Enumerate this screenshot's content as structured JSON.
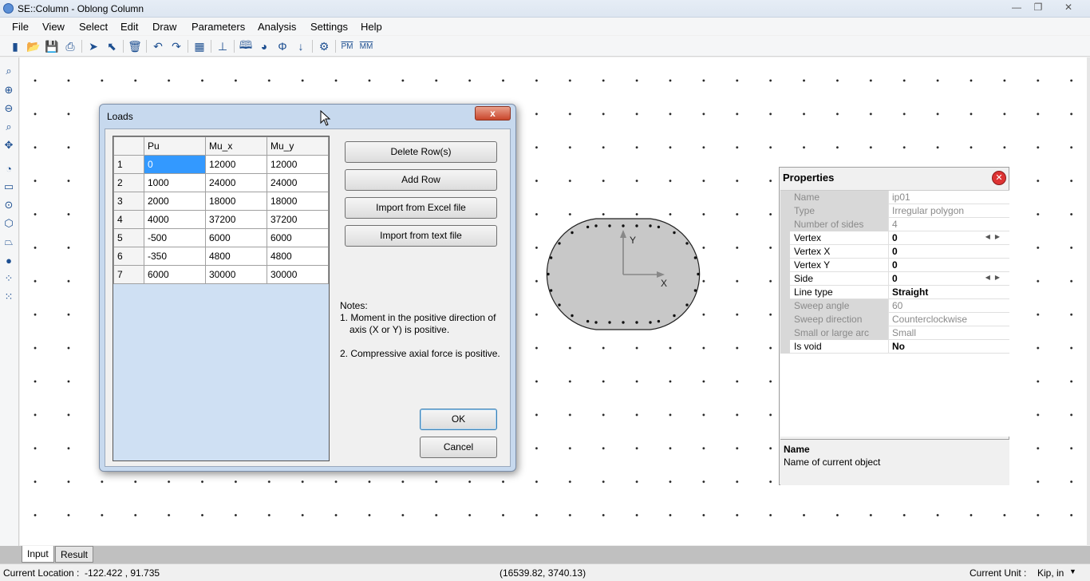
{
  "window": {
    "title": "SE::Column - Oblong Column",
    "min": "—",
    "max": "❐",
    "close": "✕"
  },
  "menu": [
    "File",
    "View",
    "Select",
    "Edit",
    "Draw",
    "Parameters",
    "Analysis",
    "Settings",
    "Help"
  ],
  "toolbar": {
    "icons": [
      "new-icon",
      "open-icon",
      "save-icon",
      "print-icon",
      "select-icon",
      "select-node-icon",
      "delete-icon",
      "undo-icon",
      "redo-icon",
      "calculator-icon",
      "tree-icon",
      "book-icon",
      "pie-icon",
      "phi-icon",
      "arrow-down-icon",
      "gear-icon",
      "pm-icon",
      "mm-icon"
    ],
    "pm_label": "PM",
    "mm_label": "MM"
  },
  "lefttools": [
    "zoom-icon",
    "zoom-in-icon",
    "zoom-out-icon",
    "zoom-window-icon",
    "pan-icon",
    "circle-tool-icon",
    "rectangle-tool-icon",
    "circle-center-icon",
    "polygon-icon",
    "irregular-polygon-icon",
    "point-icon",
    "circle-points-icon",
    "grid-points-icon"
  ],
  "dialog": {
    "title": "Loads",
    "close": "x",
    "columns": [
      "",
      "Pu",
      "Mu_x",
      "Mu_y"
    ],
    "rows": [
      {
        "n": "1",
        "pu": "0",
        "mux": "12000",
        "muy": "12000"
      },
      {
        "n": "2",
        "pu": "1000",
        "mux": "24000",
        "muy": "24000"
      },
      {
        "n": "3",
        "pu": "2000",
        "mux": "18000",
        "muy": "18000"
      },
      {
        "n": "4",
        "pu": "4000",
        "mux": "37200",
        "muy": "37200"
      },
      {
        "n": "5",
        "pu": "-500",
        "mux": "6000",
        "muy": "6000"
      },
      {
        "n": "6",
        "pu": "-350",
        "mux": "4800",
        "muy": "4800"
      },
      {
        "n": "7",
        "pu": "6000",
        "mux": "30000",
        "muy": "30000"
      }
    ],
    "buttons": {
      "delete": "Delete Row(s)",
      "add": "Add Row",
      "import_excel": "Import from Excel file",
      "import_text": "Import from text file",
      "ok": "OK",
      "cancel": "Cancel"
    },
    "notes": {
      "heading": "Notes:",
      "n1a": "1. Moment in the positive direction of",
      "n1b": "axis (X or Y) is positive.",
      "n2": "2. Compressive axial force is positive."
    }
  },
  "section": {
    "x_label": "X",
    "y_label": "Y"
  },
  "properties": {
    "title": "Properties",
    "close": "✕",
    "rows": [
      {
        "name": "Name",
        "value": "ip01",
        "disabled": true
      },
      {
        "name": "Type",
        "value": "Irregular polygon",
        "disabled": true
      },
      {
        "name": "Number of sides",
        "value": "4",
        "disabled": true
      },
      {
        "name": "Vertex",
        "value": "0",
        "disabled": false,
        "spin": true
      },
      {
        "name": "Vertex X",
        "value": "0",
        "disabled": false
      },
      {
        "name": "Vertex Y",
        "value": "0",
        "disabled": false
      },
      {
        "name": "Side",
        "value": "0",
        "disabled": false,
        "spin": true
      },
      {
        "name": "Line type",
        "value": "Straight",
        "disabled": false
      },
      {
        "name": "Sweep angle",
        "value": "60",
        "disabled": true
      },
      {
        "name": "Sweep direction",
        "value": "Counterclockwise",
        "disabled": true
      },
      {
        "name": "Small or large arc",
        "value": "Small",
        "disabled": true
      },
      {
        "name": "Is void",
        "value": "No",
        "disabled": false
      }
    ],
    "desc_title": "Name",
    "desc_text": "Name of current object"
  },
  "tabs": [
    "Input",
    "Result"
  ],
  "status": {
    "location_label": "Current Location :",
    "location_value": "-122.422 , 91.735",
    "coords": "(16539.82, 3740.13)",
    "unit_label": "Current Unit :",
    "unit_value": "Kip, in"
  }
}
